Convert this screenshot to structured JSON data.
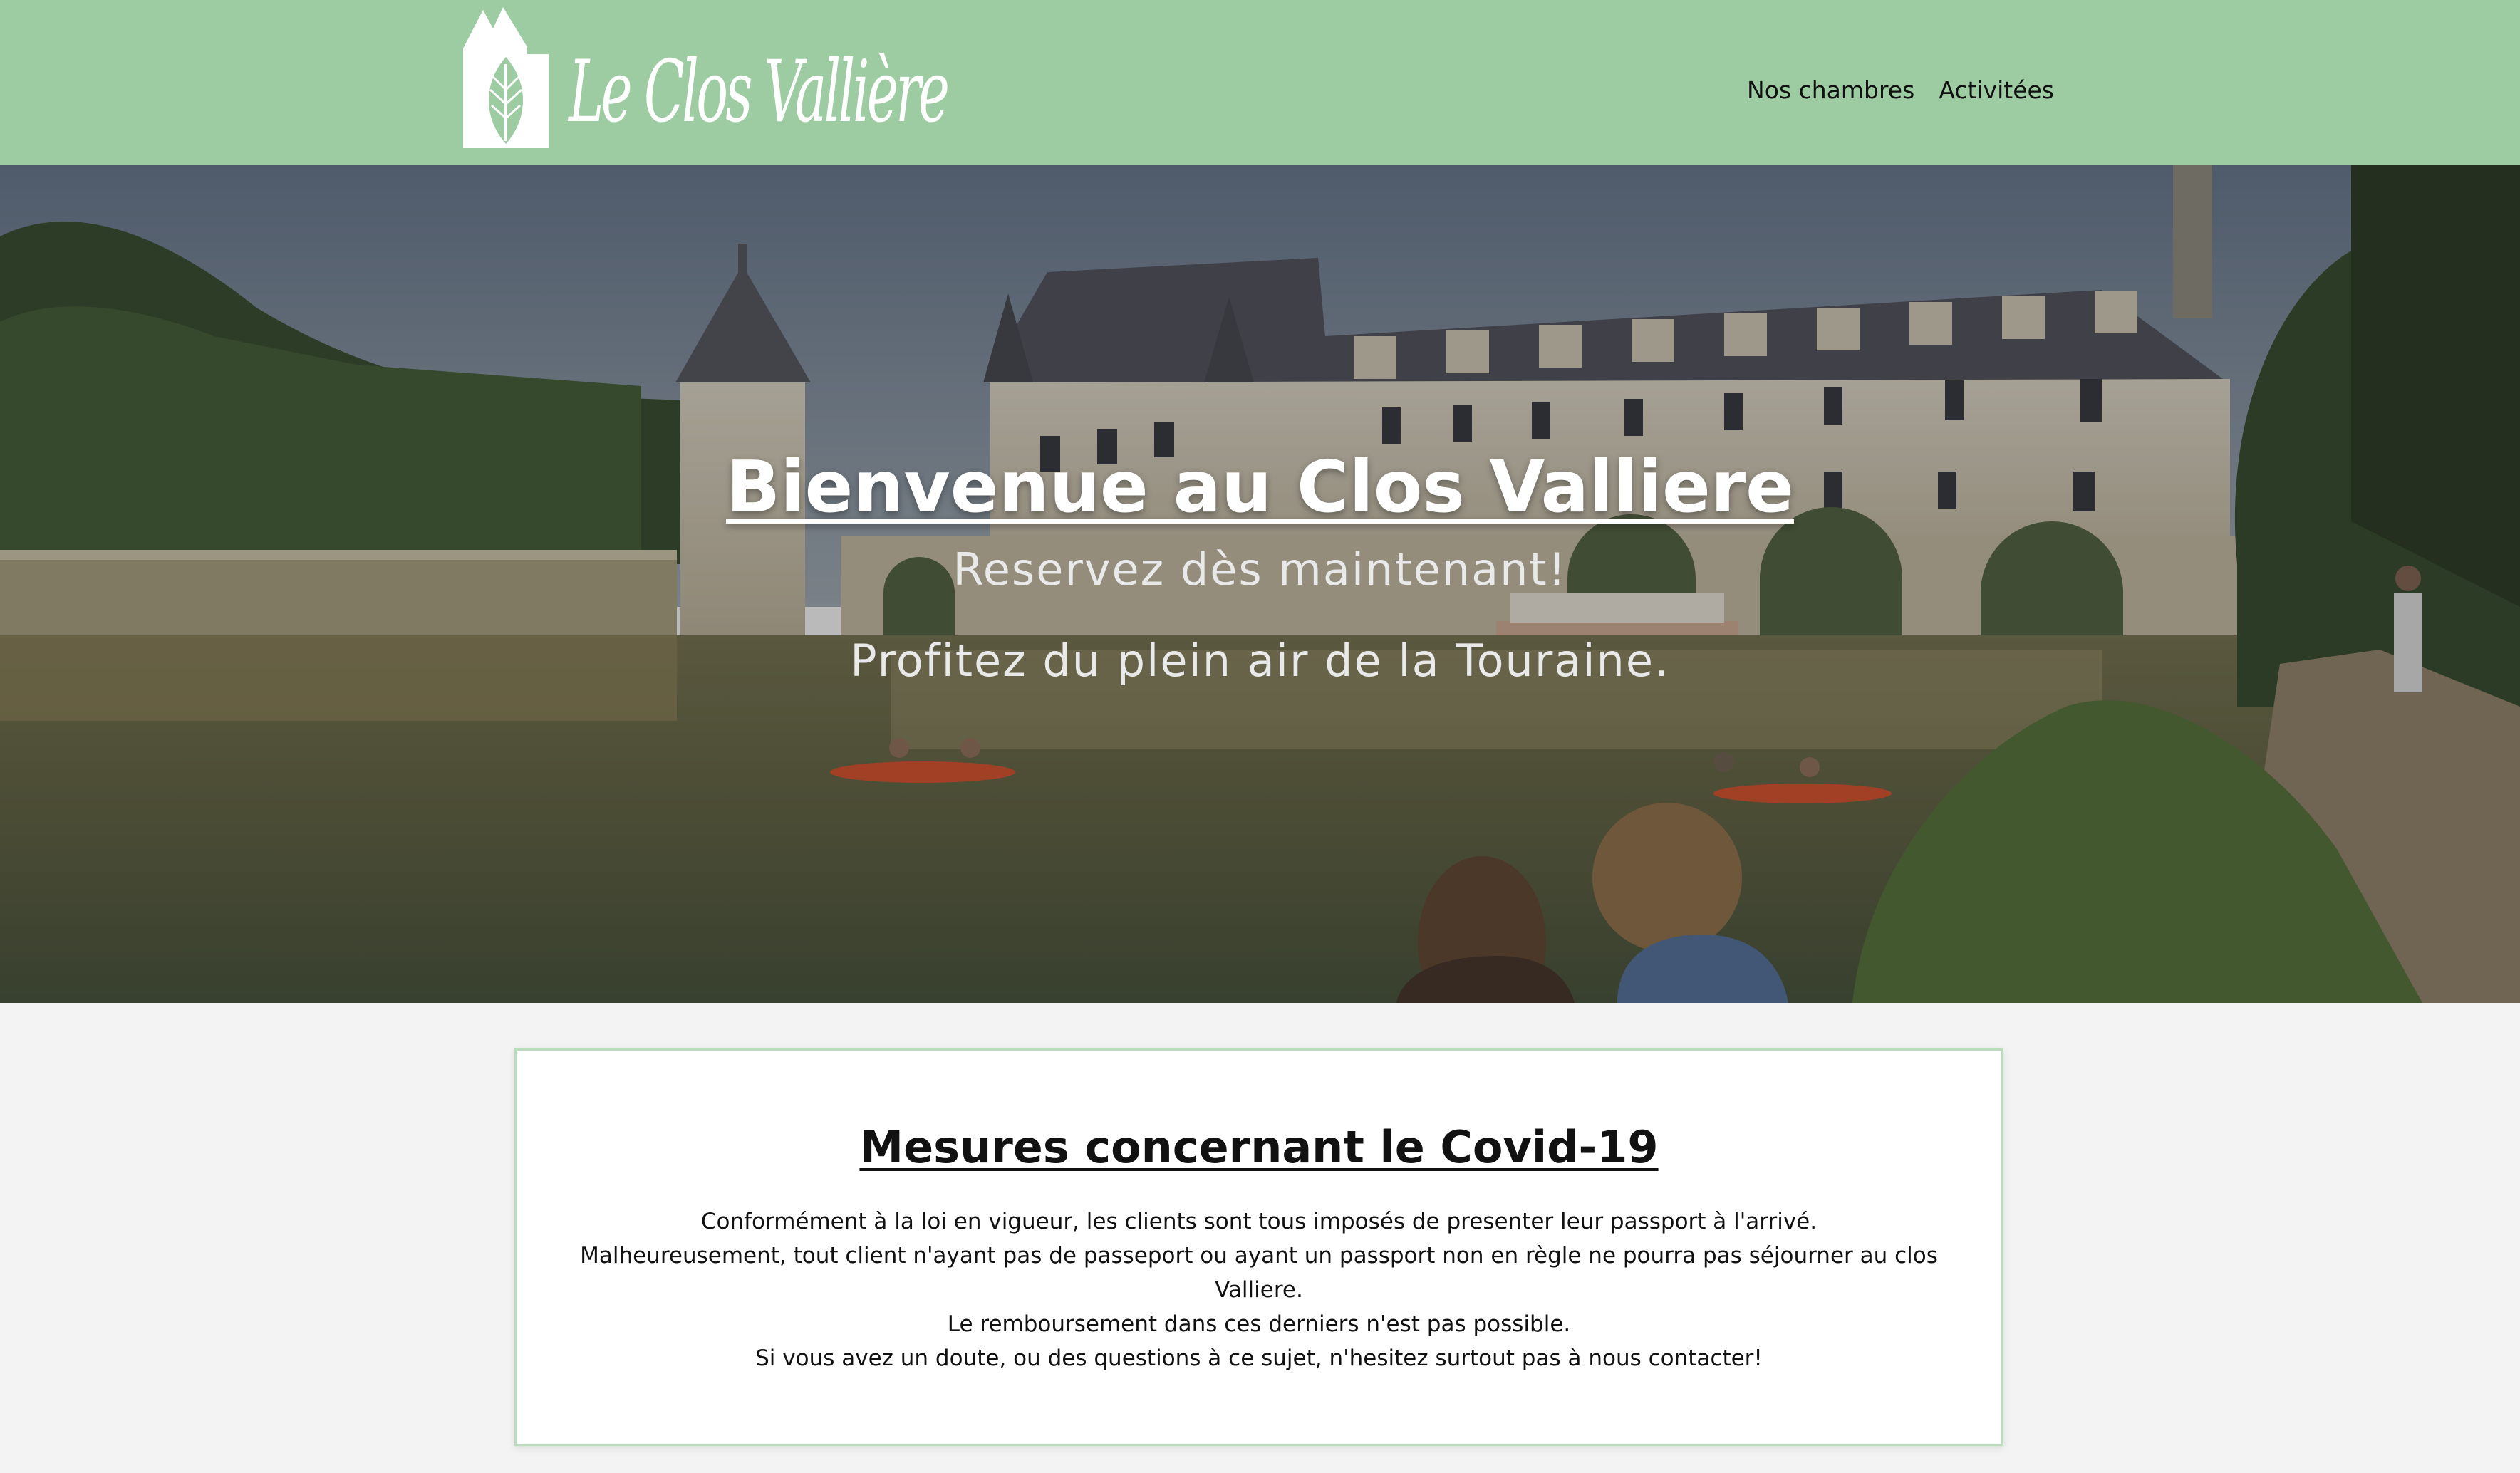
{
  "header": {
    "logo_text": "Le Clos Vallière",
    "logo_icon": "house-leaf-icon",
    "nav": [
      {
        "label": "Nos chambres"
      },
      {
        "label": "Activitées"
      }
    ],
    "background": "#9ecca2"
  },
  "hero": {
    "title": "Bienvenue au Clos Valliere",
    "subtitle_1": "Reservez dès maintenant!",
    "subtitle_2": "Profitez du plein air de la Touraine."
  },
  "covid": {
    "title": "Mesures concernant le Covid-19",
    "lines": [
      "Conformément à la loi en vigueur, les clients sont tous imposés de presenter leur passport à l'arrivé.",
      "Malheureusement, tout client n'ayant pas de passeport ou ayant un passport non en règle ne pourra pas séjourner au clos Valliere.",
      "Le remboursement dans ces derniers n'est pas possible.",
      "Si vous avez un doute, ou des questions à ce sujet, n'hesitez surtout pas à nous contacter!"
    ],
    "border_color": "#b9dcbb"
  }
}
